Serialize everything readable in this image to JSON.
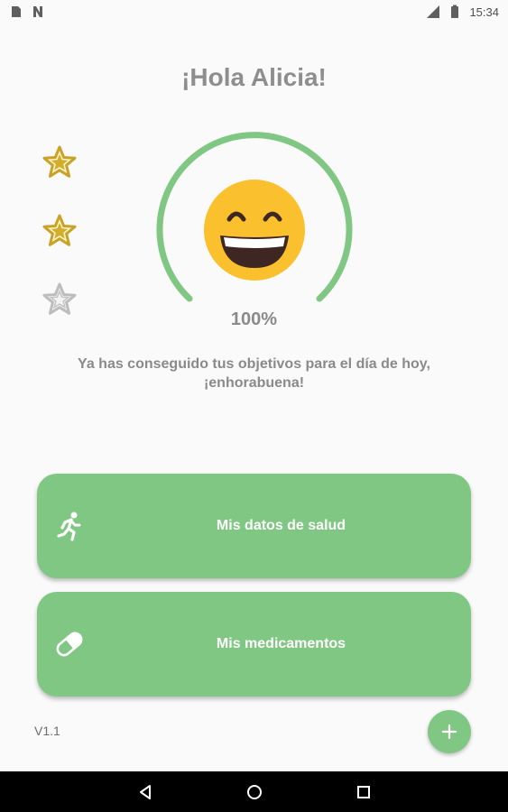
{
  "status_bar": {
    "time": "15:34",
    "left_icons": [
      "sim-card-icon",
      "notification-n-icon"
    ],
    "right_icons": [
      "signal-icon",
      "battery-icon"
    ]
  },
  "greeting": "¡Hola Alicia!",
  "stars": [
    {
      "icon": "star-filled-icon",
      "filled": true
    },
    {
      "icon": "star-filled-icon",
      "filled": true
    },
    {
      "icon": "star-outline-icon",
      "filled": false
    }
  ],
  "progress": {
    "percent_label": "100%",
    "value": 1.0,
    "emoji": "grinning-face-icon"
  },
  "message": {
    "line1": "Ya has conseguido tus objetivos para el día de hoy,",
    "line2": "¡enhorabuena!"
  },
  "buttons": {
    "health": {
      "label": "Mis datos de salud",
      "icon": "running-person-icon"
    },
    "meds": {
      "label": "Mis medicamentos",
      "icon": "pill-icon"
    }
  },
  "version": "V1.1",
  "fab": {
    "icon": "plus-icon"
  },
  "nav": {
    "back": "back-icon",
    "home": "home-icon",
    "recents": "recents-icon"
  },
  "colors": {
    "accent": "#81c784",
    "star_gold": "#c9a227",
    "star_gray": "#bdbdbd",
    "emoji": "#fbc02d",
    "text_gray": "#8a8a8a"
  }
}
